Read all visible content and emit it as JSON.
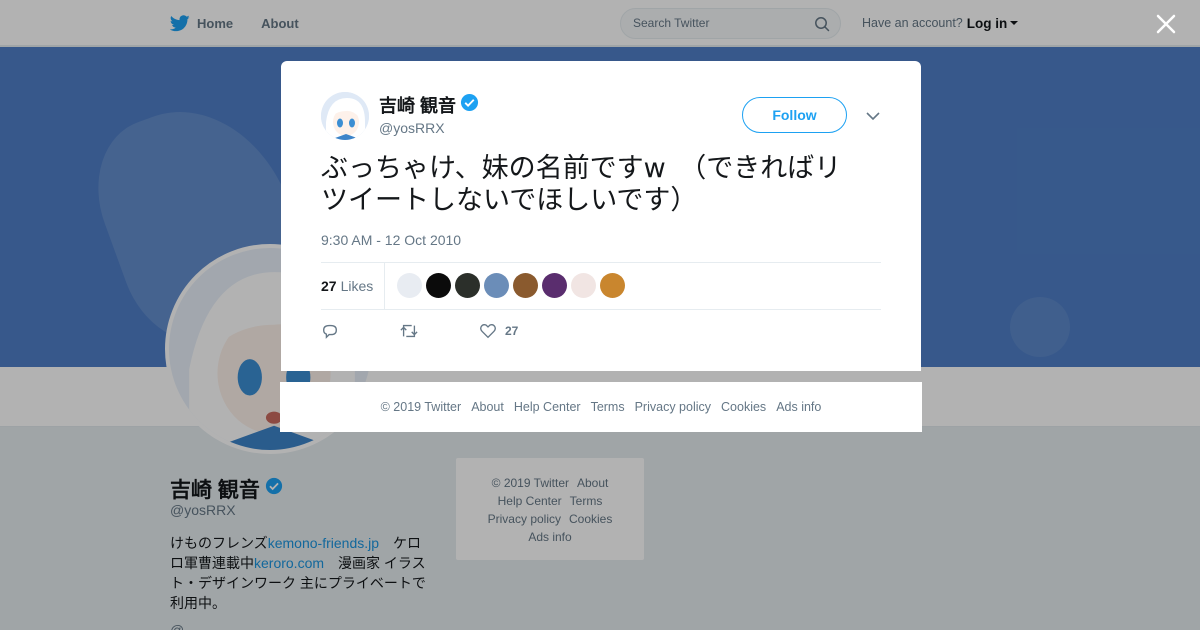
{
  "nav": {
    "home_label": "Home",
    "about_label": "About",
    "search_placeholder": "Search Twitter",
    "have_account": "Have an account?",
    "login_label": "Log in"
  },
  "profile": {
    "name": "吉崎 観音",
    "handle": "@yosRRX",
    "bio_1": "けものフレンズ",
    "bio_link_1": "kemono-friends.jp",
    "bio_2": "　ケロロ軍曹連載中",
    "bio_link_2": "keroro.com",
    "bio_3": "　漫画家 イラスト・デザインワーク 主にプライベートで利用中。",
    "more": "@ ..."
  },
  "side_footer": {
    "copyright": "© 2019 Twitter",
    "about": "About",
    "help": "Help Center",
    "terms": "Terms",
    "privacy": "Privacy policy",
    "cookies": "Cookies",
    "ads": "Ads info"
  },
  "tweet": {
    "author_name": "吉崎 観音",
    "author_handle": "@yosRRX",
    "follow_label": "Follow",
    "text_line_1": "ぶっちゃけ、妹の名前ですw　（できればリ",
    "text_line_2": "ツイートしないでほしいです）",
    "timestamp": "9:30 AM - 12 Oct 2010",
    "likes_count": "27",
    "likes_label": "Likes",
    "like_action_count": "27",
    "liker_colors": [
      "#e8ecf2",
      "#0b0b0b",
      "#2b2f2a",
      "#6b8db8",
      "#8a5a2e",
      "#5a2d6e",
      "#f1e5e3",
      "#c9862e"
    ]
  },
  "modal_footer": {
    "copyright": "© 2019 Twitter",
    "about": "About",
    "help": "Help Center",
    "terms": "Terms",
    "privacy": "Privacy policy",
    "cookies": "Cookies",
    "ads": "Ads info"
  },
  "colors": {
    "twitter_blue": "#1da1f2",
    "banner_blue": "#4f7fc7",
    "muted_text": "#657786"
  }
}
